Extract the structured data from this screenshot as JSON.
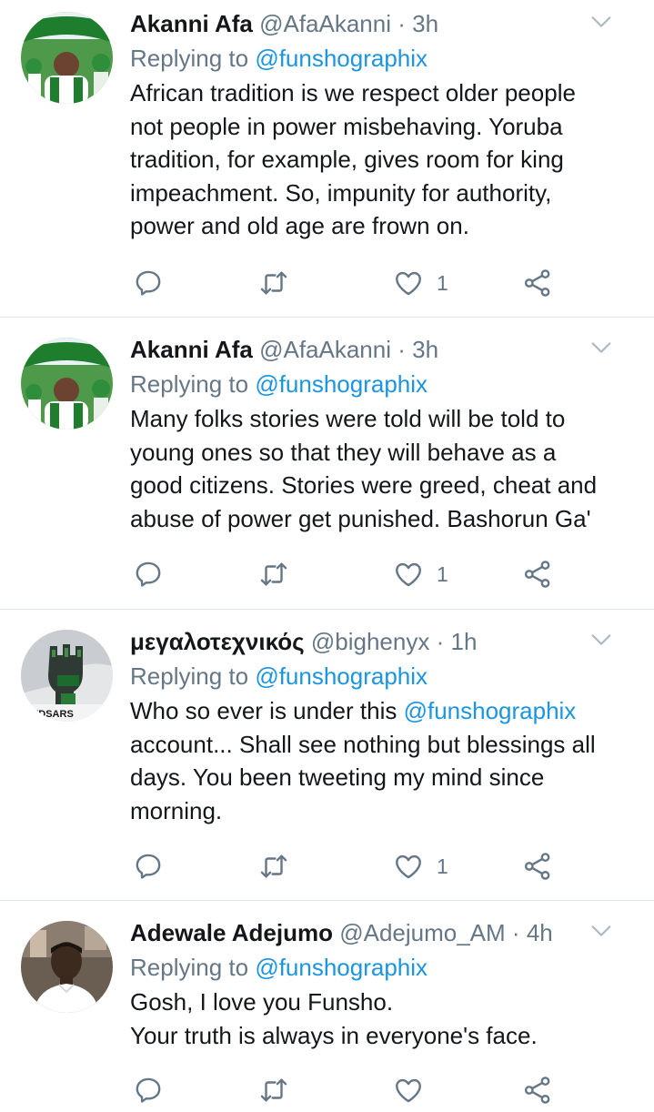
{
  "tweets": [
    {
      "name": "Akanni Afa",
      "handle": "@AfaAkanni",
      "separator": "·",
      "time": "3h",
      "replying_prefix": "Replying to",
      "replying_to": "@funshographix",
      "text_lines": [
        "African tradition is we respect older people",
        "not people in power misbehaving. Yoruba",
        "tradition, for example, gives room for king",
        "impeachment. So, impunity for authority,",
        "power and old age are frown on."
      ],
      "like_count": "1",
      "avatar": "nigeria-fan-avatar"
    },
    {
      "name": "Akanni Afa",
      "handle": "@AfaAkanni",
      "separator": "·",
      "time": "3h",
      "replying_prefix": "Replying to",
      "replying_to": "@funshographix",
      "text_lines": [
        "Many folks stories were told will be told to",
        "young ones so that they will behave as a",
        "good citizens. Stories were greed, cheat and",
        "abuse of power get punished. Bashorun Ga'"
      ],
      "like_count": "1",
      "avatar": "nigeria-fan-avatar"
    },
    {
      "name": "μεγαλοτεχνικός",
      "handle": "@bighenyx",
      "separator": "·",
      "time": "1h",
      "replying_prefix": "Replying to",
      "replying_to": "@funshographix",
      "text_line1_prefix": "Who so ever is under this ",
      "text_line1_mention": "@funshographix",
      "text_lines": [
        "account... Shall see nothing but blessings all",
        "days. You been tweeting my mind since",
        "morning."
      ],
      "like_count": "1",
      "avatar_caption": "ENDSARS",
      "avatar": "raised-fist-avatar"
    },
    {
      "name": "Adewale Adejumo",
      "handle": "@Adejumo_AM",
      "separator": "·",
      "time": "4h",
      "replying_prefix": "Replying to",
      "replying_to": "@funshographix",
      "text_lines": [
        "Gosh, I love you Funsho.",
        "Your truth is always in everyone's face."
      ],
      "like_count": "",
      "avatar": "portrait-photo-avatar"
    }
  ],
  "colors": {
    "text": "#14171a",
    "muted": "#657786",
    "link": "#1b95e0",
    "divider": "#e1e8ed"
  },
  "icons": [
    "reply-icon",
    "retweet-icon",
    "heart-icon",
    "share-icon",
    "chevron-down-icon"
  ]
}
